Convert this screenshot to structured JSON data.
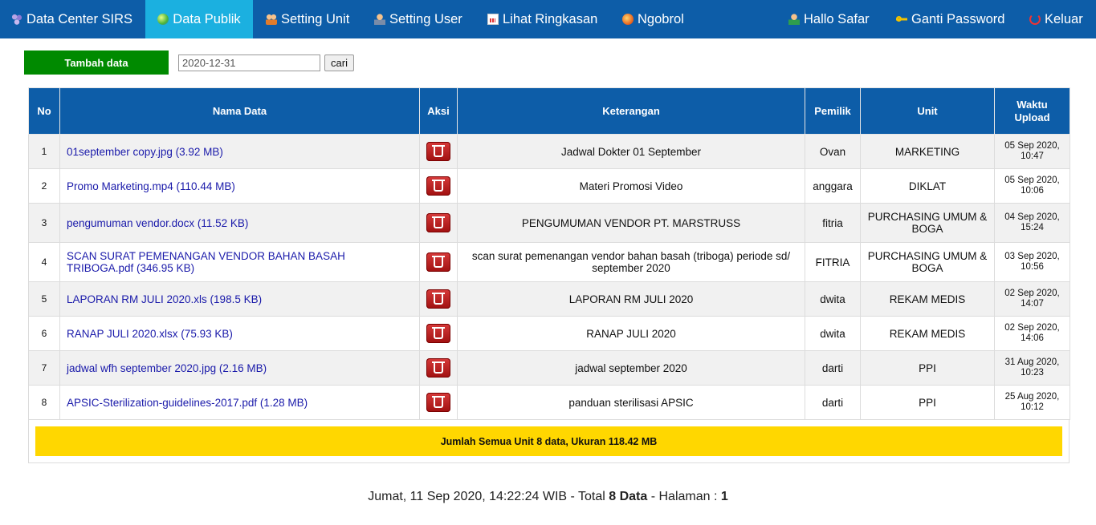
{
  "nav": {
    "left": [
      {
        "label": "Data Center SIRS",
        "icon": "flower-icon",
        "active": false
      },
      {
        "label": "Data Publik",
        "icon": "globe-icon",
        "active": true
      },
      {
        "label": "Setting Unit",
        "icon": "users-icon",
        "active": false
      },
      {
        "label": "Setting User",
        "icon": "user-icon",
        "active": false
      },
      {
        "label": "Lihat Ringkasan",
        "icon": "report-icon",
        "active": false
      },
      {
        "label": "Ngobrol",
        "icon": "chat-icon",
        "active": false
      }
    ],
    "right": [
      {
        "label": "Hallo Safar",
        "icon": "person-icon"
      },
      {
        "label": "Ganti Password",
        "icon": "key-icon"
      },
      {
        "label": "Keluar",
        "icon": "logout-icon"
      }
    ]
  },
  "toolbar": {
    "add_label": "Tambah data",
    "date_value": "2020-12-31",
    "search_label": "cari"
  },
  "table": {
    "headers": {
      "no": "No",
      "name": "Nama Data",
      "action": "Aksi",
      "desc": "Keterangan",
      "owner": "Pemilik",
      "unit": "Unit",
      "time": "Waktu Upload"
    },
    "rows": [
      {
        "no": "1",
        "name": "01september copy.jpg (3.92 MB)",
        "desc": "Jadwal Dokter 01 September",
        "owner": "Ovan",
        "unit": "MARKETING",
        "time": "05 Sep 2020, 10:47"
      },
      {
        "no": "2",
        "name": "Promo Marketing.mp4 (110.44 MB)",
        "desc": "Materi Promosi Video",
        "owner": "anggara",
        "unit": "DIKLAT",
        "time": "05 Sep 2020, 10:06"
      },
      {
        "no": "3",
        "name": "pengumuman vendor.docx (11.52 KB)",
        "desc": "PENGUMUMAN VENDOR PT. MARSTRUSS",
        "owner": "fitria",
        "unit": "PURCHASING UMUM & BOGA",
        "time": "04 Sep 2020, 15:24"
      },
      {
        "no": "4",
        "name": "SCAN SURAT PEMENANGAN VENDOR BAHAN BASAH TRIBOGA.pdf (346.95 KB)",
        "desc": "scan surat pemenangan vendor bahan basah (triboga) periode sd/ september 2020",
        "owner": "FITRIA",
        "unit": "PURCHASING UMUM & BOGA",
        "time": "03 Sep 2020, 10:56"
      },
      {
        "no": "5",
        "name": "LAPORAN RM JULI 2020.xls (198.5 KB)",
        "desc": "LAPORAN RM JULI 2020",
        "owner": "dwita",
        "unit": "REKAM MEDIS",
        "time": "02 Sep 2020, 14:07"
      },
      {
        "no": "6",
        "name": "RANAP JULI 2020.xlsx (75.93 KB)",
        "desc": "RANAP JULI 2020",
        "owner": "dwita",
        "unit": "REKAM MEDIS",
        "time": "02 Sep 2020, 14:06"
      },
      {
        "no": "7",
        "name": "jadwal wfh september 2020.jpg (2.16 MB)",
        "desc": "jadwal september 2020",
        "owner": "darti",
        "unit": "PPI",
        "time": "31 Aug 2020, 10:23"
      },
      {
        "no": "8",
        "name": "APSIC-Sterilization-guidelines-2017.pdf (1.28 MB)",
        "desc": "panduan sterilisasi APSIC",
        "owner": "darti",
        "unit": "PPI",
        "time": "25 Aug 2020, 10:12"
      }
    ]
  },
  "summary": "Jumlah Semua Unit 8 data, Ukuran 118.42 MB",
  "footer": {
    "prefix": "Jumat, 11 Sep 2020, 14:22:24 WIB - Total ",
    "total": "8 Data",
    "middle": " - Halaman : ",
    "page": "1"
  },
  "colors": {
    "nav_bg": "#0d5da8",
    "nav_active": "#1bb0e0",
    "add_button": "#008a00",
    "summary_bg": "#ffd700",
    "link": "#1a1aaa"
  }
}
